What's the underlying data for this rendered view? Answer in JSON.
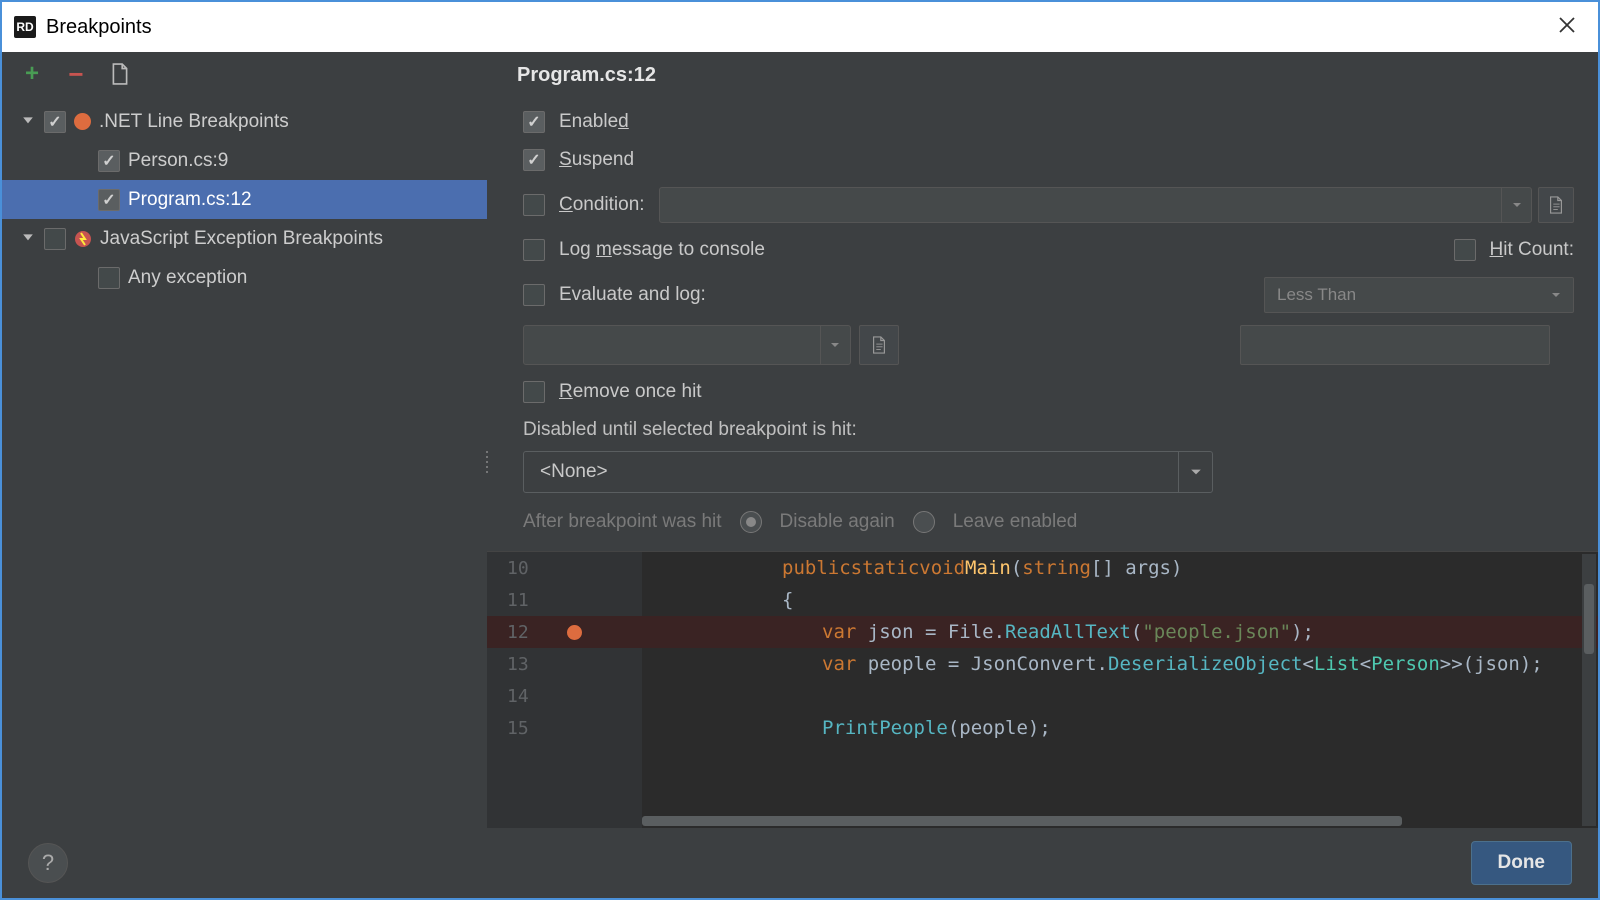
{
  "titlebar": {
    "app_icon_text": "RD",
    "title": "Breakpoints",
    "close_tooltip": "Close"
  },
  "toolbar": {
    "add_tooltip": "Add",
    "remove_tooltip": "Remove",
    "view_options_tooltip": "View Options"
  },
  "tree": {
    "groups": [
      {
        "label": ".NET Line Breakpoints",
        "checked": true,
        "expanded": true,
        "icon": "breakpoint-dot",
        "items": [
          {
            "label": "Person.cs:9",
            "checked": true,
            "selected": false
          },
          {
            "label": "Program.cs:12",
            "checked": true,
            "selected": true
          }
        ]
      },
      {
        "label": "JavaScript Exception Breakpoints",
        "checked": false,
        "expanded": true,
        "icon": "js-exception",
        "items": [
          {
            "label": "Any exception",
            "checked": false,
            "selected": false
          }
        ]
      }
    ]
  },
  "detail": {
    "title": "Program.cs:12",
    "enabled": {
      "label": "Enabled",
      "mnemonic_index": 6,
      "checked": true
    },
    "suspend": {
      "label": "Suspend",
      "mnemonic_index": 0,
      "checked": true
    },
    "condition": {
      "label": "Condition:",
      "mnemonic_index": 0,
      "checked": false,
      "value": ""
    },
    "log_message": {
      "label": "Log message to console",
      "mnemonic_index": 4,
      "checked": false
    },
    "hit_count": {
      "label": "Hit Count:",
      "mnemonic_index": 0,
      "checked": false,
      "comparison": "Less Than",
      "value": ""
    },
    "evaluate_log": {
      "label": "Evaluate and log:",
      "checked": false,
      "value": ""
    },
    "remove_once_hit": {
      "label": "Remove once hit",
      "mnemonic_index": 0,
      "checked": false
    },
    "disabled_until": {
      "label": "Disabled until selected breakpoint is hit:",
      "selected": "<None>"
    },
    "after_hit": {
      "label": "After breakpoint was hit",
      "options": [
        {
          "label": "Disable again",
          "checked": true
        },
        {
          "label": "Leave enabled",
          "checked": false
        }
      ]
    }
  },
  "code": {
    "lines": [
      {
        "num": 10,
        "text_html": "<span class='kw'>public</span> <span class='kw'>static</span> <span class='kw'>void</span> <span class='fn'>Main</span>(<span class='kw'>string</span>[] args)",
        "indent": 0
      },
      {
        "num": 11,
        "text_html": "{",
        "indent": 0
      },
      {
        "num": 12,
        "text_html": "    <span class='kw'>var</span> json = File.<span class='method'>ReadAllText</span>(<span class='str'>\"people.json\"</span>);",
        "indent": 0,
        "bp": true
      },
      {
        "num": 13,
        "text_html": "    <span class='kw'>var</span> people = JsonConvert.<span class='method'>DeserializeObject</span>&lt;<span class='type'>List</span>&lt;<span class='type'>Person</span>&gt;&gt;(json);",
        "indent": 0
      },
      {
        "num": 14,
        "text_html": "",
        "indent": 0
      },
      {
        "num": 15,
        "text_html": "    <span class='method'>PrintPeople</span>(people);",
        "indent": 0
      }
    ]
  },
  "footer": {
    "help": "?",
    "done": "Done"
  }
}
